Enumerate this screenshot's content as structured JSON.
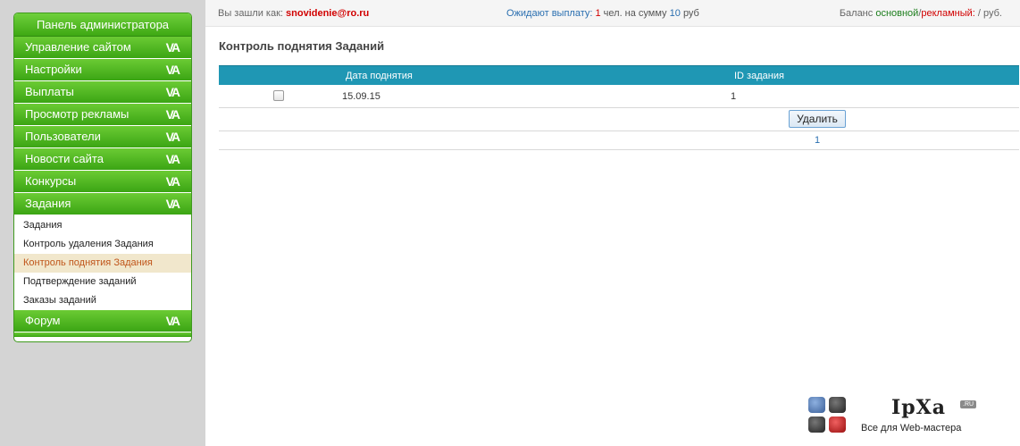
{
  "sidebar": {
    "title": "Панель администратора",
    "items": [
      {
        "label": "Управление сайтом",
        "chevron": "VA"
      },
      {
        "label": "Настройки",
        "chevron": "VA"
      },
      {
        "label": "Выплаты",
        "chevron": "VA"
      },
      {
        "label": "Просмотр рекламы",
        "chevron": "VA"
      },
      {
        "label": "Пользователи",
        "chevron": "VA"
      },
      {
        "label": "Новости сайта",
        "chevron": "VA"
      },
      {
        "label": "Конкурсы",
        "chevron": "VA"
      },
      {
        "label": "Задания",
        "chevron": "VA"
      }
    ],
    "subitems": [
      {
        "label": "Задания"
      },
      {
        "label": "Контроль удаления Задания"
      },
      {
        "label": "Контроль поднятия Задания"
      },
      {
        "label": "Подтверждение заданий"
      },
      {
        "label": "Заказы заданий"
      }
    ],
    "last_item": {
      "label": "Форум",
      "chevron": "VA"
    }
  },
  "topbar": {
    "logged_in_label": "Вы зашли как:",
    "username": "snovidenie@ro.ru",
    "pending_label": "Ожидают выплату:",
    "pending_count": "1",
    "pending_mid": "чел. на сумму",
    "pending_amount": "10",
    "pending_currency": "руб",
    "balance_label": "Баланс",
    "balance_main": "основной",
    "balance_sep": "/",
    "balance_ad": "рекламный:",
    "balance_value": "/ руб."
  },
  "main": {
    "title": "Контроль поднятия Заданий",
    "columns": [
      "Дата поднятия",
      "ID задания"
    ],
    "rows": [
      {
        "date": "15.09.15",
        "id": "1"
      }
    ],
    "delete_label": "Удалить",
    "page": "1"
  },
  "logo": {
    "name": "IpXa",
    "tld": ".RU",
    "subtitle": "Все для Web-мастера"
  },
  "colors": {
    "accent_green": "#4cb81e",
    "grid_header": "#1f97b4",
    "highlight_red": "#d10000"
  }
}
